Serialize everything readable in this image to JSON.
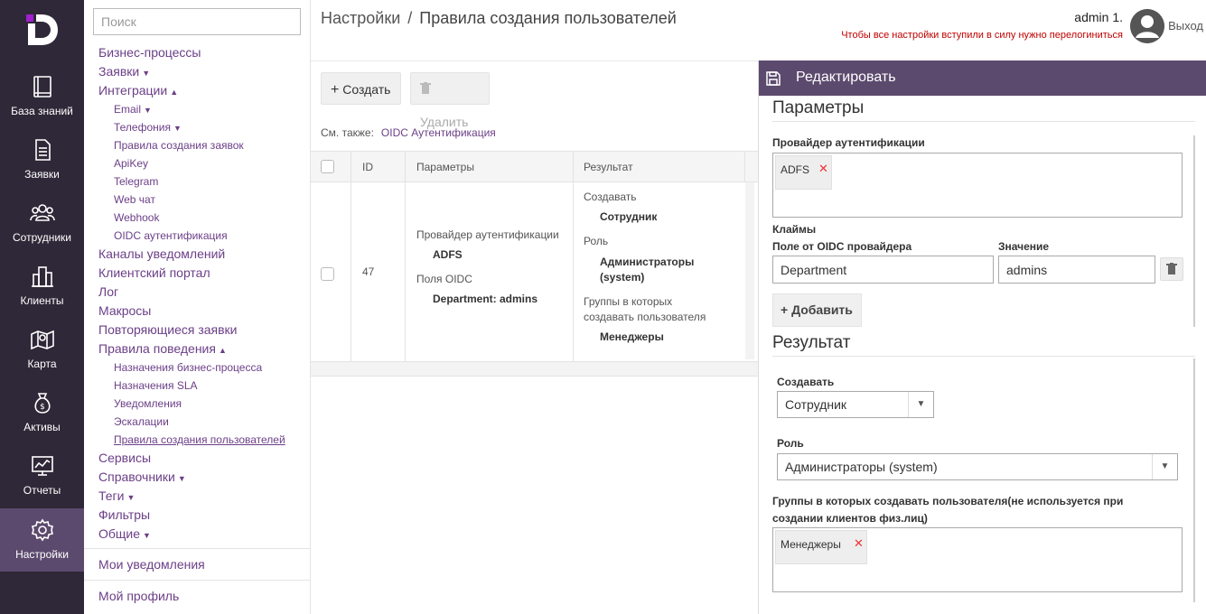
{
  "nav": [
    {
      "label": "База знаний",
      "icon": "book-icon"
    },
    {
      "label": "Заявки",
      "icon": "document-icon"
    },
    {
      "label": "Сотрудники",
      "icon": "people-icon"
    },
    {
      "label": "Клиенты",
      "icon": "buildings-icon"
    },
    {
      "label": "Карта",
      "icon": "map-icon"
    },
    {
      "label": "Активы",
      "icon": "money-bag-icon"
    },
    {
      "label": "Отчеты",
      "icon": "monitor-chart-icon"
    },
    {
      "label": "Настройки",
      "icon": "gear-icon"
    }
  ],
  "search": {
    "placeholder": "Поиск"
  },
  "tree": {
    "business_processes": "Бизнес-процессы",
    "requests": "Заявки",
    "integrations": "Интеграции",
    "email": "Email",
    "telephony": "Телефония",
    "request_rules": "Правила создания заявок",
    "apikey": "ApiKey",
    "telegram": "Telegram",
    "webchat": "Web чат",
    "webhook": "Webhook",
    "oidc_auth": "OIDC аутентификация",
    "notification_channels": "Каналы уведомлений",
    "client_portal": "Клиентский портал",
    "log": "Лог",
    "macros": "Макросы",
    "recurring_requests": "Повторяющиеся заявки",
    "behavior_rules": "Правила поведения",
    "bp_assignments": "Назначения бизнес-процесса",
    "sla_assignments": "Назначения SLA",
    "notifications": "Уведомления",
    "escalations": "Эскалации",
    "user_creation_rules": "Правила создания пользователей",
    "services": "Сервисы",
    "directories": "Справочники",
    "tags": "Теги",
    "filters": "Фильтры",
    "general": "Общие",
    "my_notifications": "Мои уведомления",
    "my_profile": "Мой профиль"
  },
  "header": {
    "breadcrumb_root": "Настройки",
    "breadcrumb_sep": "/",
    "breadcrumb_current": "Правила создания пользователей",
    "username": "admin 1.",
    "relogin_notice": "Чтобы все настройки вступили в силу нужно перелогиниться",
    "logout": "Выход"
  },
  "toolbar": {
    "create": "Создать",
    "delete": "Удалить"
  },
  "see_also": {
    "label": "См. также:",
    "link": "OIDC Аутентификация"
  },
  "table": {
    "headers": {
      "id": "ID",
      "params": "Параметры",
      "result": "Результат"
    },
    "row": {
      "id": "47",
      "provider_label": "Провайдер аутентификации",
      "provider_value": "ADFS",
      "oidc_fields_label": "Поля OIDC",
      "oidc_fields_value": "Department: admins",
      "create_label": "Создавать",
      "create_value": "Сотрудник",
      "role_label": "Роль",
      "role_value_1": "Администраторы",
      "role_value_2": "(system)",
      "groups_label_1": "Группы в которых",
      "groups_label_2": "создавать пользователя",
      "groups_value": "Менеджеры"
    }
  },
  "edit": {
    "title": "Редактировать",
    "params_title": "Параметры",
    "provider_label": "Провайдер аутентификации",
    "provider_tag": "ADFS",
    "claims_label": "Клаймы",
    "oidc_field_label": "Поле от OIDC провайдера",
    "value_label": "Значение",
    "oidc_field_value": "Department",
    "value_value": "admins",
    "add_button": "Добавить",
    "result_title": "Результат",
    "create_label": "Создавать",
    "create_value": "Сотрудник",
    "role_label": "Роль",
    "role_value": "Администраторы (system)",
    "groups_label_1": "Группы в которых создавать пользователя(не используется при",
    "groups_label_2": "создании клиентов физ.лиц)",
    "groups_tag": "Менеджеры"
  },
  "colors": {
    "nav_bg": "#2f2838",
    "accent": "#5c4a6e",
    "link": "#6b3f87",
    "logo": "#a020d0",
    "notice": "#c00000"
  }
}
